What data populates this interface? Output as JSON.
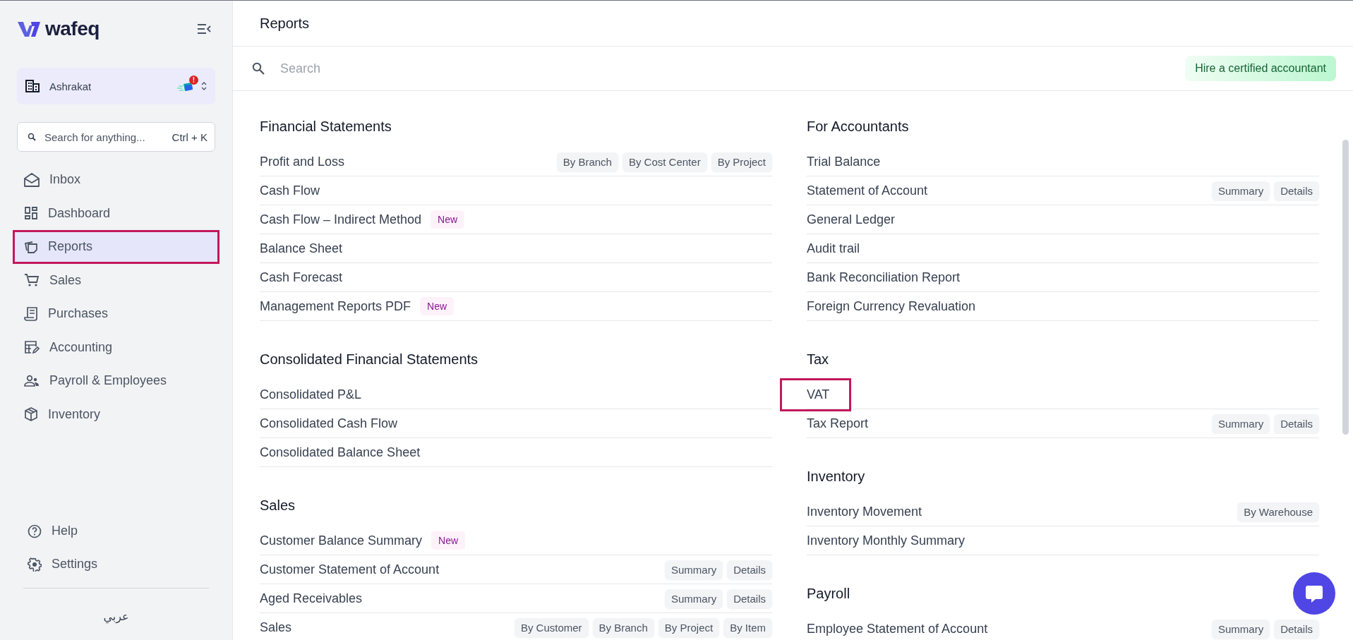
{
  "sidebar": {
    "brand": "wafeq",
    "organization": {
      "name": "Ashrakat",
      "alert_badge": "!"
    },
    "search": {
      "placeholder": "Search for anything...",
      "shortcut": "Ctrl + K"
    },
    "nav": [
      {
        "label": "Inbox",
        "selected": false,
        "highlighted": false
      },
      {
        "label": "Dashboard",
        "selected": false,
        "highlighted": false
      },
      {
        "label": "Reports",
        "selected": true,
        "highlighted": true
      },
      {
        "label": "Sales",
        "selected": false,
        "highlighted": false
      },
      {
        "label": "Purchases",
        "selected": false,
        "highlighted": false
      },
      {
        "label": "Accounting",
        "selected": false,
        "highlighted": false
      },
      {
        "label": "Payroll & Employees",
        "selected": false,
        "highlighted": false
      },
      {
        "label": "Inventory",
        "selected": false,
        "highlighted": false
      }
    ],
    "footer": [
      {
        "label": "Help"
      },
      {
        "label": "Settings"
      }
    ],
    "language": "عربي"
  },
  "page": {
    "title": "Reports"
  },
  "search": {
    "placeholder": "Search"
  },
  "hire_button": "Hire a certified accountant",
  "columns": [
    [
      {
        "title": "Financial Statements",
        "reports": [
          {
            "label": "Profit and Loss",
            "chips": [
              "By Branch",
              "By Cost Center",
              "By Project"
            ],
            "highlighted": false
          },
          {
            "label": "Cash Flow",
            "highlighted": false
          },
          {
            "label": "Cash Flow – Indirect Method",
            "badge": "New",
            "highlighted": false
          },
          {
            "label": "Balance Sheet",
            "highlighted": false
          },
          {
            "label": "Cash Forecast",
            "highlighted": false
          },
          {
            "label": "Management Reports PDF",
            "badge": "New",
            "highlighted": false
          }
        ]
      },
      {
        "title": "Consolidated Financial Statements",
        "reports": [
          {
            "label": "Consolidated P&L",
            "highlighted": false
          },
          {
            "label": "Consolidated Cash Flow",
            "highlighted": false
          },
          {
            "label": "Consolidated Balance Sheet",
            "highlighted": false
          }
        ]
      },
      {
        "title": "Sales",
        "reports": [
          {
            "label": "Customer Balance Summary",
            "badge": "New",
            "highlighted": false
          },
          {
            "label": "Customer Statement of Account",
            "chips": [
              "Summary",
              "Details"
            ],
            "highlighted": false
          },
          {
            "label": "Aged Receivables",
            "chips": [
              "Summary",
              "Details"
            ],
            "highlighted": false
          },
          {
            "label": "Sales",
            "chips": [
              "By Customer",
              "By Branch",
              "By Project",
              "By Item"
            ],
            "highlighted": false
          }
        ]
      }
    ],
    [
      {
        "title": "For Accountants",
        "reports": [
          {
            "label": "Trial Balance",
            "highlighted": false
          },
          {
            "label": "Statement of Account",
            "chips": [
              "Summary",
              "Details"
            ],
            "highlighted": false
          },
          {
            "label": "General Ledger",
            "highlighted": false
          },
          {
            "label": "Audit trail",
            "highlighted": false
          },
          {
            "label": "Bank Reconciliation Report",
            "highlighted": false
          },
          {
            "label": "Foreign Currency Revaluation",
            "highlighted": false
          }
        ]
      },
      {
        "title": "Tax",
        "reports": [
          {
            "label": "VAT",
            "highlighted": true
          },
          {
            "label": "Tax Report",
            "chips": [
              "Summary",
              "Details"
            ],
            "highlighted": false
          }
        ]
      },
      {
        "title": "Inventory",
        "reports": [
          {
            "label": "Inventory Movement",
            "chips": [
              "By Warehouse"
            ],
            "highlighted": false
          },
          {
            "label": "Inventory Monthly Summary",
            "highlighted": false
          }
        ]
      },
      {
        "title": "Payroll",
        "reports": [
          {
            "label": "Employee Statement of Account",
            "chips": [
              "Summary",
              "Details"
            ],
            "highlighted": false
          }
        ]
      }
    ]
  ]
}
